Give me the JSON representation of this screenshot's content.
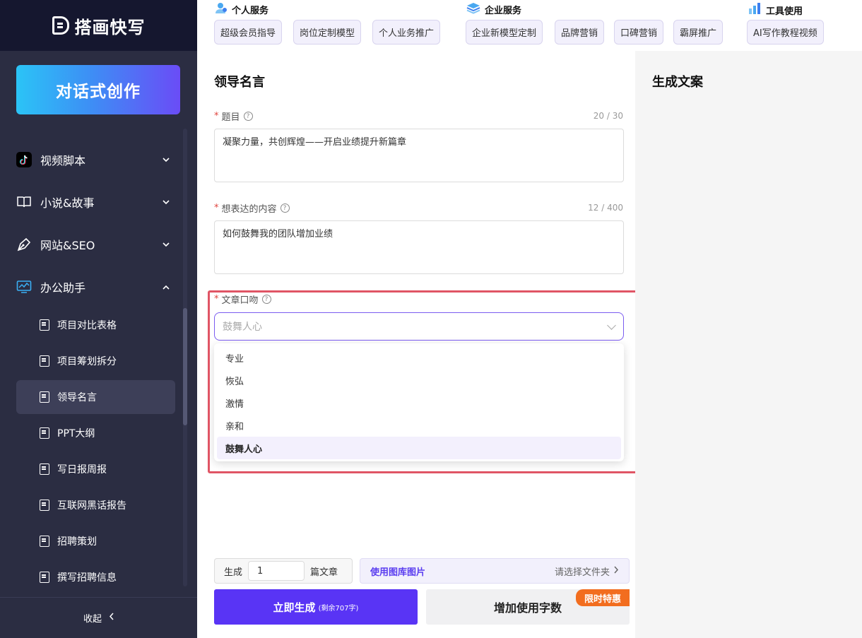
{
  "app": {
    "logo_text": "搭画快写",
    "create_button": "对话式创作",
    "collapse_label": "收起"
  },
  "topnav": {
    "categories": [
      {
        "title": "个人服务",
        "icon": "personal-service-icon",
        "tags": [
          "超级会员指导",
          "岗位定制模型",
          "个人业务推广"
        ]
      },
      {
        "title": "企业服务",
        "icon": "enterprise-service-icon",
        "tags": [
          "企业新模型定制",
          "品牌营销",
          "口碑营销",
          "霸屏推广"
        ]
      },
      {
        "title": "工具使用",
        "icon": "tool-usage-icon",
        "tags": [
          "AI写作教程视频"
        ]
      }
    ]
  },
  "sidebar": {
    "groups": [
      {
        "label": "视频脚本",
        "icon": "tiktok-icon",
        "expanded": false
      },
      {
        "label": "小说&故事",
        "icon": "book-icon",
        "expanded": false
      },
      {
        "label": "网站&SEO",
        "icon": "pen-icon",
        "expanded": false
      },
      {
        "label": "办公助手",
        "icon": "monitor-icon",
        "expanded": true
      }
    ],
    "sub_items": [
      "项目对比表格",
      "项目筹划拆分",
      "领导名言",
      "PPT大纲",
      "写日报周报",
      "互联网黑话报告",
      "招聘策划",
      "撰写招聘信息"
    ],
    "active_sub_item": "领导名言"
  },
  "form": {
    "title": "领导名言",
    "topic": {
      "label": "题目",
      "counter": "20 / 30",
      "value": "凝聚力量，共创辉煌——开启业绩提升新篇章"
    },
    "content": {
      "label": "想表达的内容",
      "counter": "12 / 400",
      "value": "如何鼓舞我的团队增加业绩"
    },
    "tone": {
      "label": "文章口吻",
      "placeholder": "鼓舞人心",
      "options": [
        "专业",
        "恢弘",
        "激情",
        "亲和",
        "鼓舞人心"
      ],
      "selected": "鼓舞人心"
    },
    "generate": {
      "prefix": "生成",
      "count": "1",
      "suffix": "篇文章"
    },
    "library": {
      "label": "使用图库图片",
      "pick": "请选择文件夹"
    },
    "generate_button": {
      "label": "立即生成",
      "note": "(剩余707字)"
    },
    "add_words_button": "增加使用字数",
    "promo_badge": "限时特惠"
  },
  "right_panel": {
    "title": "生成文案"
  },
  "colors": {
    "accent": "#5934f5",
    "sidebar_bg": "#2b2d42",
    "highlight": "#e05565",
    "promo": "#f26d1f"
  }
}
